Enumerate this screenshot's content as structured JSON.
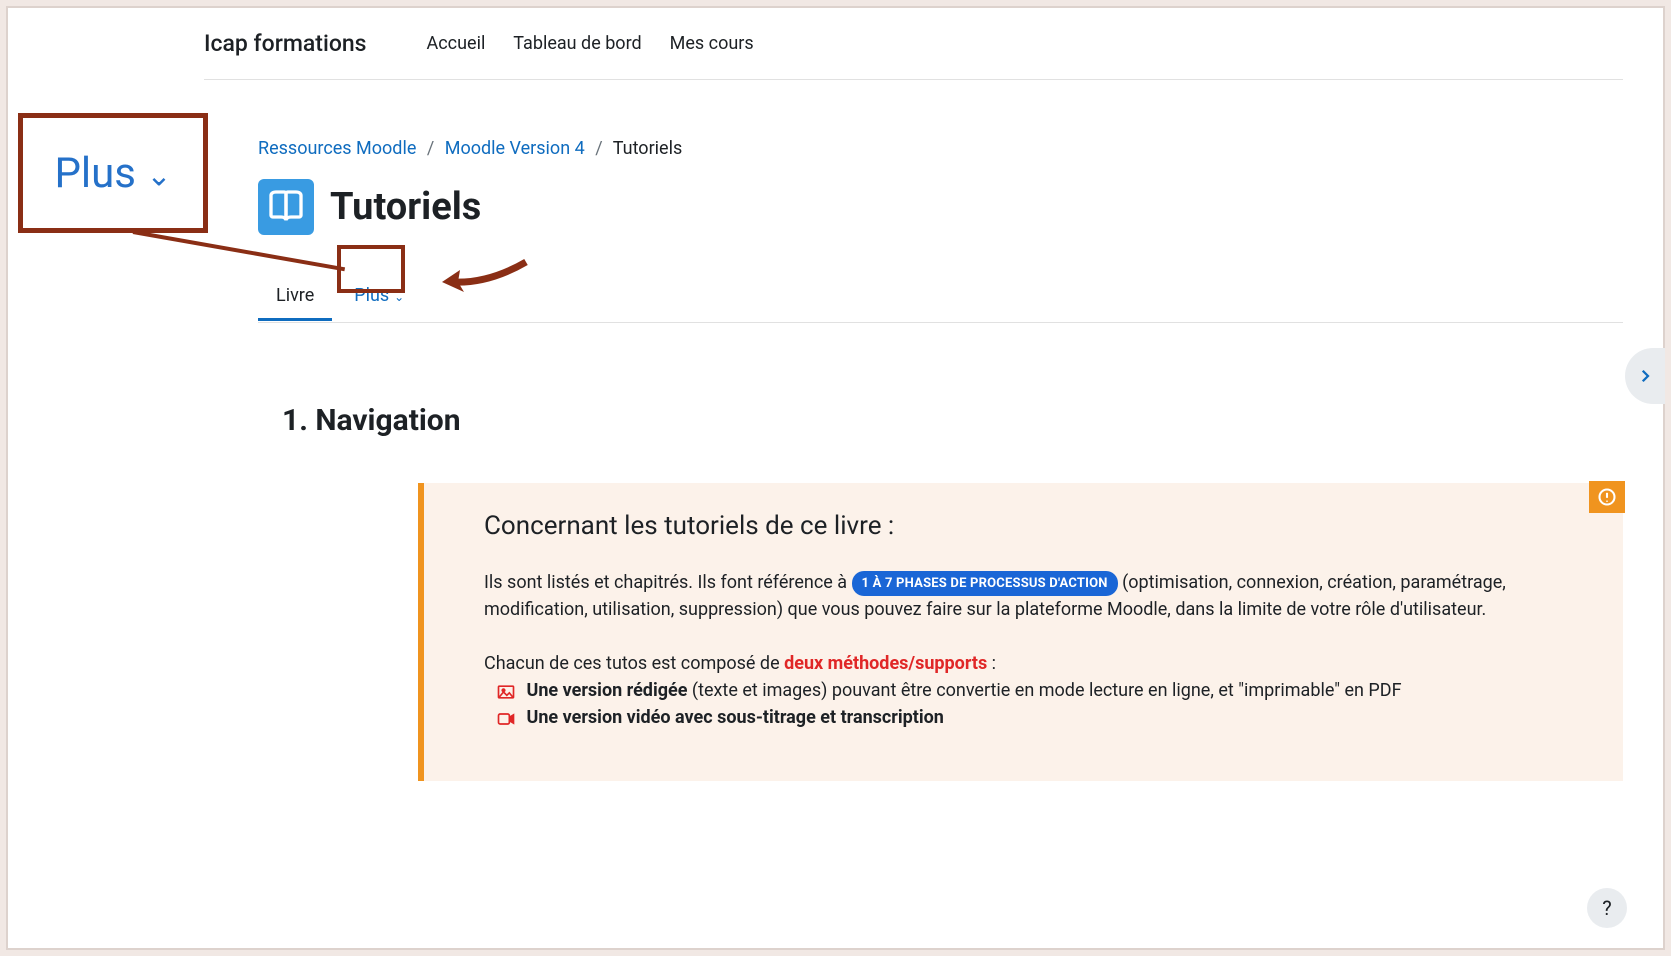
{
  "header": {
    "brand": "Icap formations",
    "nav": [
      "Accueil",
      "Tableau de bord",
      "Mes cours"
    ]
  },
  "breadcrumb": {
    "items": [
      "Ressources Moodle",
      "Moodle Version 4",
      "Tutoriels"
    ]
  },
  "page": {
    "title": "Tutoriels",
    "section_heading": "1. Navigation"
  },
  "tabs": {
    "items": [
      "Livre",
      "Plus"
    ]
  },
  "callout": {
    "plus_label": "Plus"
  },
  "info": {
    "heading": "Concernant les tutoriels de ce livre :",
    "p1_a": "Ils sont listés et chapitrés. Ils font référence à ",
    "pill": "1 À 7 PHASES DE PROCESSUS D'ACTION",
    "p1_b": " (optimisation, connexion, création, paramétrage, modification, utilisation, suppression) que vous pouvez faire sur la plateforme Moodle, dans la limite de votre rôle d'utilisateur.",
    "p2_a": "Chacun de ces tutos est composé de ",
    "p2_red": "deux méthodes/supports",
    "p2_b": " :",
    "li1_bold": "Une version rédigée",
    "li1_rest": " (texte et images) pouvant être convertie en mode lecture en ligne, et \"imprimable\" en PDF",
    "li2_bold": "Une version vidéo avec sous-titrage et transcription"
  },
  "help": {
    "label": "?"
  }
}
